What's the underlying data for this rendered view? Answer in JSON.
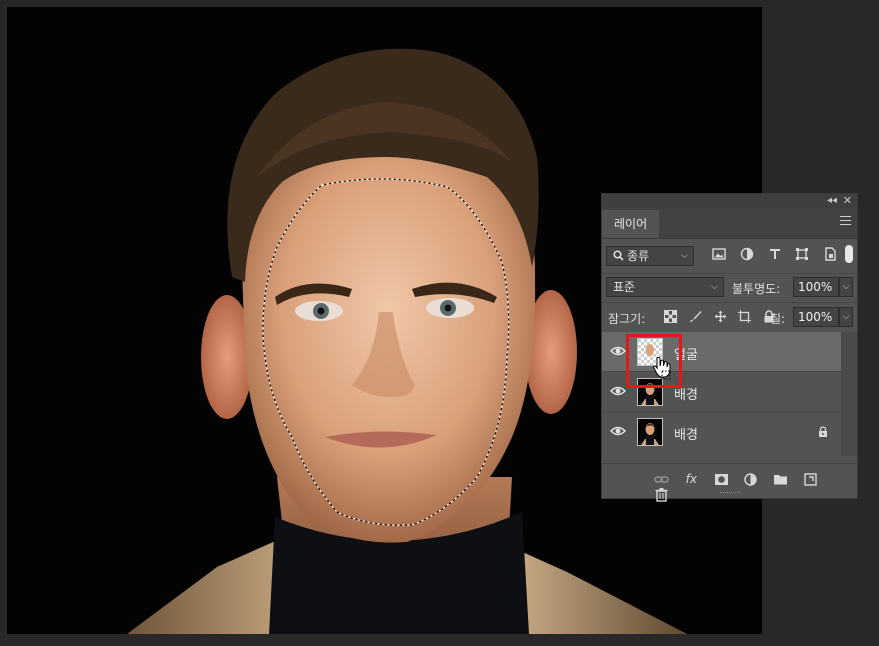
{
  "colors": {
    "app_background": "#282828",
    "panel_background": "#535353",
    "selected_row": "#6a6a6a",
    "highlight": "#e3171c",
    "skin": "#d9a07a",
    "hair": "#3a2a1c",
    "coat": "#c9a57e",
    "turtleneck": "#0e0f12"
  },
  "panel": {
    "tab_label": "레이어",
    "collapse_icon": "double-chevron-left-icon",
    "close_icon": "close-icon",
    "filter": {
      "search_icon": "search-icon",
      "value": "종류"
    },
    "blend_mode": "표준",
    "opacity_label": "불투명도:",
    "opacity_value": "100%",
    "lock_label": "잠그기:",
    "fill_label": "칠:",
    "fill_value": "100%",
    "layers": [
      {
        "name": "얼굴",
        "selected": true,
        "locked": false
      },
      {
        "name": "배경",
        "selected": false,
        "locked": false
      },
      {
        "name": "배경",
        "selected": false,
        "locked": true
      }
    ],
    "bottom_icons": [
      "link-icon",
      "fx-icon",
      "mask-icon",
      "adjustment-icon",
      "folder-icon",
      "new-layer-icon",
      "trash-icon"
    ],
    "fx_label": "fx"
  }
}
